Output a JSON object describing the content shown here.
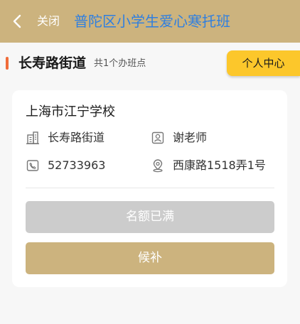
{
  "header": {
    "back_icon": "chevron-left-icon",
    "close_label": "关闭",
    "title": "普陀区小学生爱心寒托班",
    "background": "#ccb37e",
    "title_color": "#2f7fe0"
  },
  "section": {
    "title": "长寿路街道",
    "count_text": "共1个办班点",
    "accent": "#f06c3a"
  },
  "personal_center": {
    "label": "个人中心",
    "color": "#fcc72b"
  },
  "card": {
    "school_name": "上海市江宁学校",
    "street": "长寿路街道",
    "street_icon": "building-icon",
    "teacher": "谢老师",
    "teacher_icon": "person-card-icon",
    "phone": "52733963",
    "phone_icon": "phone-icon",
    "address": "西康路1518弄1号",
    "address_icon": "location-pin-icon",
    "full_button_label": "名额已满",
    "waitlist_button_label": "候补"
  }
}
